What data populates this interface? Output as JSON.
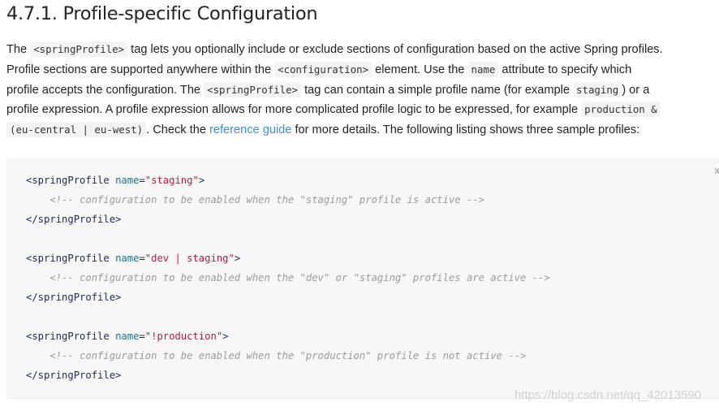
{
  "heading": "4.7.1. Profile-specific Configuration",
  "paragraph": {
    "lines": [
      [
        {
          "k": "text",
          "t": "The "
        },
        {
          "k": "code",
          "t": "<springProfile>"
        },
        {
          "k": "text",
          "t": " tag lets you optionally include or exclude sections of configuration based on the active Spring profiles."
        }
      ],
      [
        {
          "k": "text",
          "t": "Profile sections are supported anywhere within the "
        },
        {
          "k": "code",
          "t": "<configuration>"
        },
        {
          "k": "text",
          "t": " element. Use the "
        },
        {
          "k": "code",
          "t": "name"
        },
        {
          "k": "text",
          "t": " attribute to specify which"
        }
      ],
      [
        {
          "k": "text",
          "t": "profile accepts the configuration. The "
        },
        {
          "k": "code",
          "t": "<springProfile>"
        },
        {
          "k": "text",
          "t": " tag can contain a simple profile name (for example "
        },
        {
          "k": "code",
          "t": "staging"
        },
        {
          "k": "text",
          "t": ") or a"
        }
      ],
      [
        {
          "k": "text",
          "t": "profile expression. A profile expression allows for more complicated profile logic to be expressed, for example "
        },
        {
          "k": "code",
          "t": "production &"
        }
      ],
      [
        {
          "k": "code",
          "t": "(eu-central | eu-west)"
        },
        {
          "k": "text",
          "t": ". Check the "
        },
        {
          "k": "link",
          "t": "reference guide"
        },
        {
          "k": "text",
          "t": " for more details. The following listing shows three sample profiles:"
        }
      ]
    ]
  },
  "code_block": {
    "copy_label": "x",
    "lines": [
      [
        {
          "k": "tag",
          "t": "<springProfile "
        },
        {
          "k": "attr",
          "t": "name"
        },
        {
          "k": "tag",
          "t": "="
        },
        {
          "k": "str",
          "t": "\"staging\""
        },
        {
          "k": "tag",
          "t": ">"
        }
      ],
      [
        {
          "k": "cm",
          "t": "    <!-- configuration to be enabled when the \"staging\" profile is active -->"
        }
      ],
      [
        {
          "k": "tag",
          "t": "</springProfile>"
        }
      ],
      [],
      [
        {
          "k": "tag",
          "t": "<springProfile "
        },
        {
          "k": "attr",
          "t": "name"
        },
        {
          "k": "tag",
          "t": "="
        },
        {
          "k": "str",
          "t": "\"dev | staging\""
        },
        {
          "k": "tag",
          "t": ">"
        }
      ],
      [
        {
          "k": "cm",
          "t": "    <!-- configuration to be enabled when the \"dev\" or \"staging\" profiles are active -->"
        }
      ],
      [
        {
          "k": "tag",
          "t": "</springProfile>"
        }
      ],
      [],
      [
        {
          "k": "tag",
          "t": "<springProfile "
        },
        {
          "k": "attr",
          "t": "name"
        },
        {
          "k": "tag",
          "t": "="
        },
        {
          "k": "str",
          "t": "\"!production\""
        },
        {
          "k": "tag",
          "t": ">"
        }
      ],
      [
        {
          "k": "cm",
          "t": "    <!-- configuration to be enabled when the \"production\" profile is not active -->"
        }
      ],
      [
        {
          "k": "tag",
          "t": "</springProfile>"
        }
      ]
    ]
  },
  "watermark": "https://blog.csdn.net/qq_42013590",
  "colors": {
    "link": "#3c8ee0",
    "string": "#d0103a",
    "attribute": "#0a7f80",
    "comment": "#9a9a9a",
    "code_bg": "#f7f7f7"
  }
}
